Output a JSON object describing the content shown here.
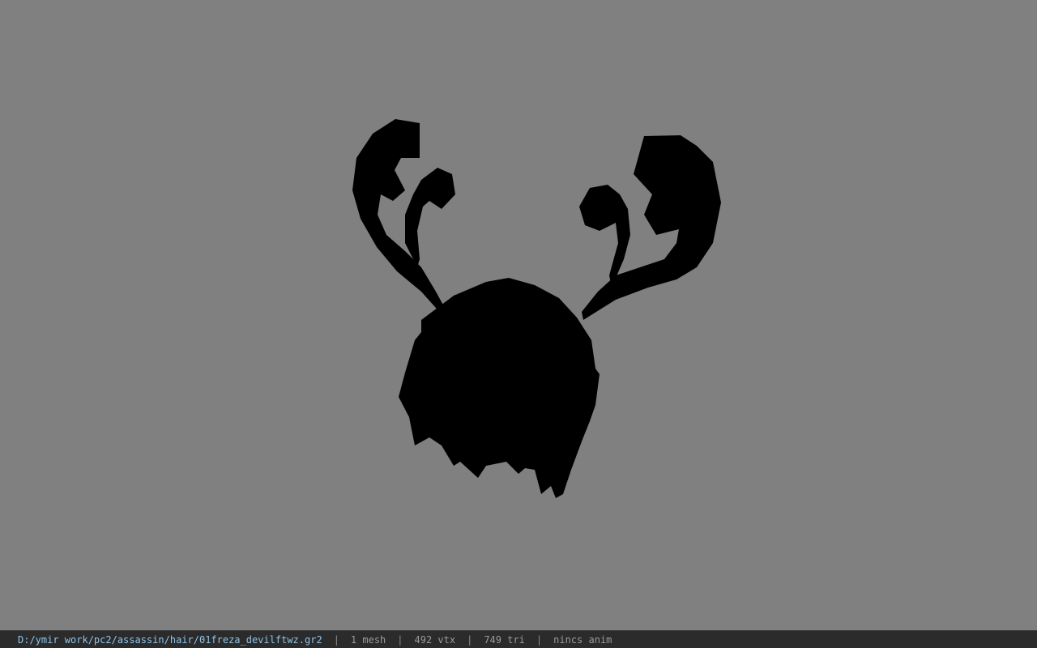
{
  "viewport": {
    "background_color": "#808080",
    "model_color": "#000000",
    "model_name": "hair-mesh-silhouette"
  },
  "statusbar": {
    "file_path": "D:/ymir work/pc2/assassin/hair/01freza_devilftwz.gr2",
    "mesh_count": "1 mesh",
    "vertex_count": "492 vtx",
    "triangle_count": "749 tri",
    "animation": "nincs anim",
    "separator": "|",
    "path_color": "#8fc3e8"
  }
}
